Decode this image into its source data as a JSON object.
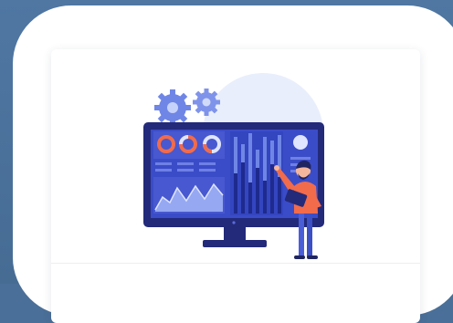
{
  "colors": {
    "background": "#4a6f98",
    "card": "#ffffff",
    "monitor_frame": "#232a7a",
    "screen": "#3b4cc8",
    "accent_orange": "#f26b4b",
    "gear": "#6f86e6",
    "halo": "#e6ecfb"
  },
  "illustration": {
    "icon_names": [
      "gear-icon",
      "monitor-icon",
      "person-icon",
      "tablet-icon"
    ]
  }
}
